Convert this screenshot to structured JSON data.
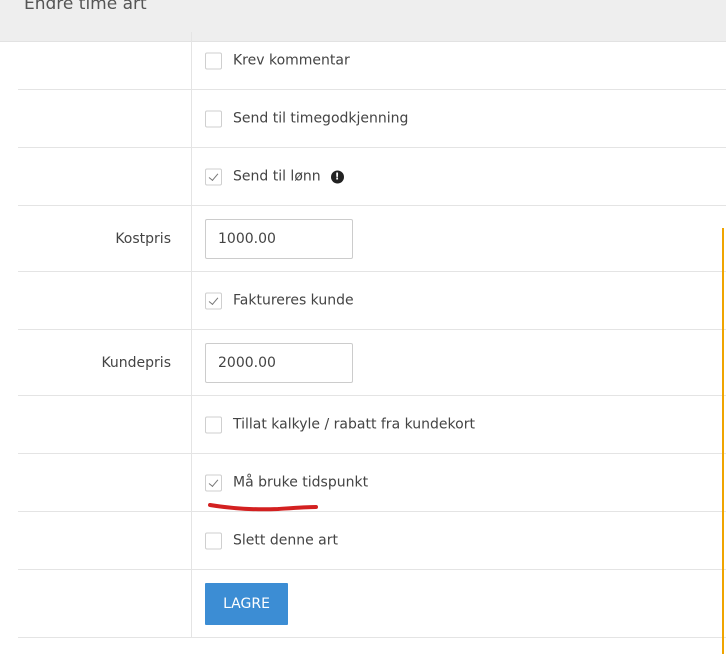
{
  "header": {
    "title": "Endre time art"
  },
  "rows": {
    "krev_kommentar": {
      "label": "Krev kommentar",
      "checked": false
    },
    "send_timegodkjenning": {
      "label": "Send til timegodkjenning",
      "checked": false
    },
    "send_lonn": {
      "label": "Send til lønn",
      "checked": true,
      "info_icon": "!"
    },
    "kostpris": {
      "label": "Kostpris",
      "value": "1000.00"
    },
    "faktureres_kunde": {
      "label": "Faktureres kunde",
      "checked": true
    },
    "kundepris": {
      "label": "Kundepris",
      "value": "2000.00"
    },
    "tillat_kalkyle": {
      "label": "Tillat kalkyle / rabatt fra kundekort",
      "checked": false
    },
    "ma_bruke_tidspunkt": {
      "label": "Må bruke tidspunkt",
      "checked": true
    },
    "slett_art": {
      "label": "Slett denne art",
      "checked": false
    }
  },
  "save_button": {
    "label": "LAGRE"
  },
  "colors": {
    "header_bg": "#eeeeee",
    "button_bg": "#3c8dd4",
    "annotation_red": "#d32020",
    "edge_orange": "#f0a500"
  }
}
